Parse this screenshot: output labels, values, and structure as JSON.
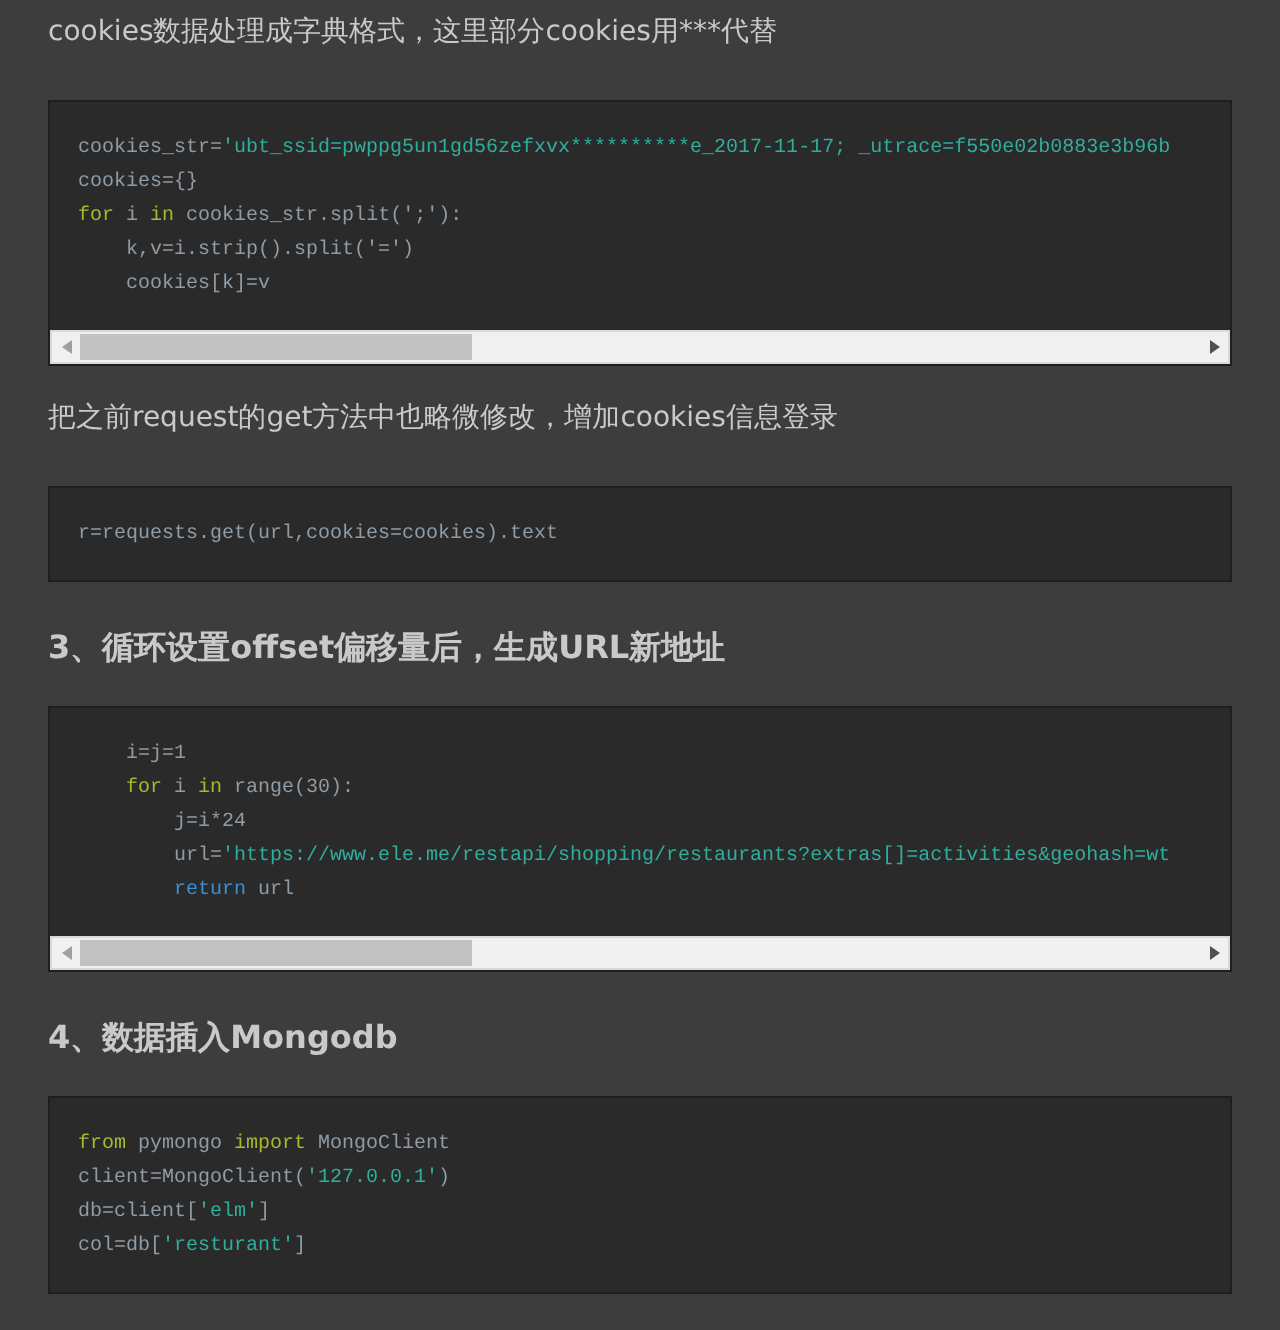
{
  "blocks": [
    {
      "kind": "paragraph",
      "text": "cookies数据处理成字典格式，这里部分cookies用***代替"
    },
    {
      "kind": "code",
      "scrollbar": true,
      "lines": [
        [
          {
            "kind": "plain",
            "s": "cookies_str="
          },
          {
            "kind": "string",
            "s": "'ubt_ssid=pwppg5un1gd56zefxvx**********e_2017-11-17; _utrace=f550e02b0883e3b96b"
          }
        ],
        [
          {
            "kind": "plain",
            "s": "cookies={}"
          }
        ],
        [
          {
            "kind": "keyword",
            "s": "for"
          },
          {
            "kind": "plain",
            "s": " i "
          },
          {
            "kind": "keyword",
            "s": "in"
          },
          {
            "kind": "plain",
            "s": " cookies_str.split(';'):"
          }
        ],
        [
          {
            "kind": "plain",
            "s": "    k,v=i.strip().split('=')"
          }
        ],
        [
          {
            "kind": "plain",
            "s": "    cookies[k]=v"
          }
        ]
      ]
    },
    {
      "kind": "paragraph",
      "text": "把之前request的get方法中也略微修改，增加cookies信息登录"
    },
    {
      "kind": "code",
      "scrollbar": false,
      "lines": [
        [
          {
            "kind": "plain",
            "s": "r=requests.get(url,cookies=cookies).text"
          }
        ]
      ]
    },
    {
      "kind": "heading",
      "text": "3、循环设置offset偏移量后，生成URL新地址"
    },
    {
      "kind": "code",
      "scrollbar": true,
      "lines": [
        [
          {
            "kind": "plain",
            "s": "    i=j=1"
          }
        ],
        [
          {
            "kind": "keyword",
            "s": "    for"
          },
          {
            "kind": "plain",
            "s": " i "
          },
          {
            "kind": "keyword",
            "s": "in"
          },
          {
            "kind": "plain",
            "s": " range(30):"
          }
        ],
        [
          {
            "kind": "plain",
            "s": "        j=i*24"
          }
        ],
        [
          {
            "kind": "plain",
            "s": "        url="
          },
          {
            "kind": "string",
            "s": "'https://www.ele.me/restapi/shopping/restaurants?extras[]=activities&geohash=wt"
          }
        ],
        [
          {
            "kind": "return",
            "s": "        return"
          },
          {
            "kind": "plain",
            "s": " url"
          }
        ]
      ]
    },
    {
      "kind": "heading",
      "text": "4、数据插入Mongodb"
    },
    {
      "kind": "code",
      "scrollbar": false,
      "lines": [
        [
          {
            "kind": "keyword",
            "s": "from"
          },
          {
            "kind": "plain",
            "s": " pymongo "
          },
          {
            "kind": "keyword",
            "s": "import"
          },
          {
            "kind": "plain",
            "s": " MongoClient"
          }
        ],
        [
          {
            "kind": "plain",
            "s": "client=MongoClient("
          },
          {
            "kind": "string",
            "s": "'127.0.0.1'"
          },
          {
            "kind": "plain",
            "s": ")"
          }
        ],
        [
          {
            "kind": "plain",
            "s": "db=client["
          },
          {
            "kind": "string",
            "s": "'elm'"
          },
          {
            "kind": "plain",
            "s": "]"
          }
        ],
        [
          {
            "kind": "plain",
            "s": "col=db["
          },
          {
            "kind": "string",
            "s": "'resturant'"
          },
          {
            "kind": "plain",
            "s": "]"
          }
        ]
      ]
    }
  ]
}
